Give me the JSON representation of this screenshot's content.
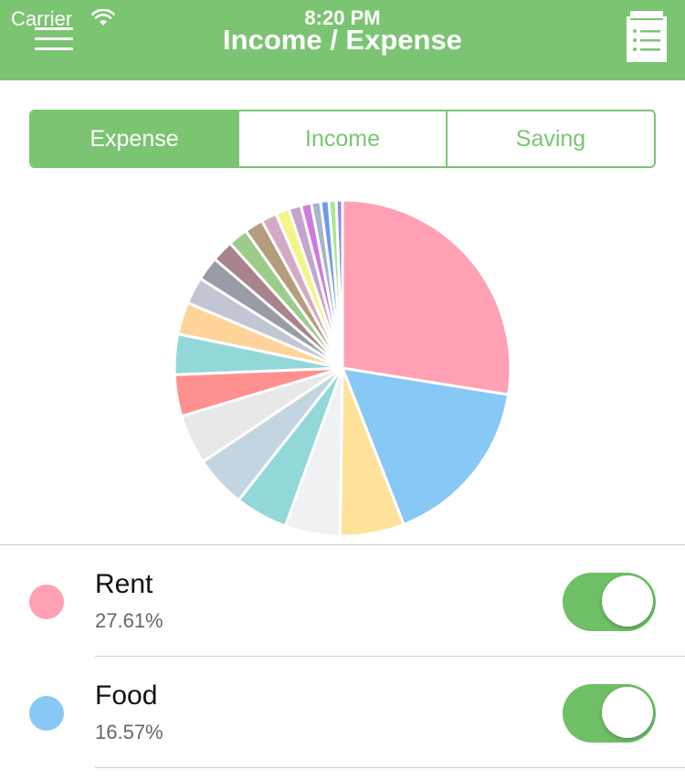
{
  "status_bar": {
    "carrier": "Carrier",
    "time": "8:20 PM"
  },
  "navbar": {
    "title": "Income / Expense",
    "menu_icon": "hamburger-menu-icon",
    "list_icon": "clipboard-list-icon"
  },
  "segments": [
    {
      "label": "Expense",
      "active": true
    },
    {
      "label": "Income",
      "active": false
    },
    {
      "label": "Saving",
      "active": false
    }
  ],
  "colors": {
    "accent": "#7bc472",
    "rent": "#ffa0b4",
    "food": "#87c8f4"
  },
  "chart_data": {
    "type": "pie",
    "slices": [
      {
        "label": "Rent",
        "value": 27.61,
        "color": "#ffa0b4"
      },
      {
        "label": "Food",
        "value": 16.57,
        "color": "#87c8f4"
      },
      {
        "label": "",
        "value": 6.2,
        "color": "#ffe29a"
      },
      {
        "label": "",
        "value": 5.3,
        "color": "#f0f1f3"
      },
      {
        "label": "",
        "value": 5.1,
        "color": "#93d8d8"
      },
      {
        "label": "",
        "value": 5.0,
        "color": "#c3d5e1"
      },
      {
        "label": "",
        "value": 4.8,
        "color": "#e8e8e8"
      },
      {
        "label": "",
        "value": 4.0,
        "color": "#ff9090"
      },
      {
        "label": "",
        "value": 3.9,
        "color": "#93d8d8"
      },
      {
        "label": "",
        "value": 3.1,
        "color": "#ffd49a"
      },
      {
        "label": "",
        "value": 2.6,
        "color": "#c2c6d4"
      },
      {
        "label": "",
        "value": 2.3,
        "color": "#999ca4"
      },
      {
        "label": "",
        "value": 2.1,
        "color": "#a9838c"
      },
      {
        "label": "",
        "value": 1.9,
        "color": "#9ccc8c"
      },
      {
        "label": "",
        "value": 1.8,
        "color": "#b59c7c"
      },
      {
        "label": "",
        "value": 1.5,
        "color": "#d4a9c4"
      },
      {
        "label": "",
        "value": 1.3,
        "color": "#f4f488"
      },
      {
        "label": "",
        "value": 1.2,
        "color": "#c4a4cc"
      },
      {
        "label": "",
        "value": 1.0,
        "color": "#cc7cdc"
      },
      {
        "label": "",
        "value": 0.9,
        "color": "#a6b4cc"
      },
      {
        "label": "",
        "value": 0.8,
        "color": "#6c9ce8"
      },
      {
        "label": "",
        "value": 0.7,
        "color": "#a8e88c"
      },
      {
        "label": "",
        "value": 0.6,
        "color": "#8c8cec"
      }
    ]
  },
  "categories": [
    {
      "name": "Rent",
      "percent": "27.61%",
      "color": "#ffa0b4",
      "enabled": true
    },
    {
      "name": "Food",
      "percent": "16.57%",
      "color": "#87c8f4",
      "enabled": true
    }
  ]
}
